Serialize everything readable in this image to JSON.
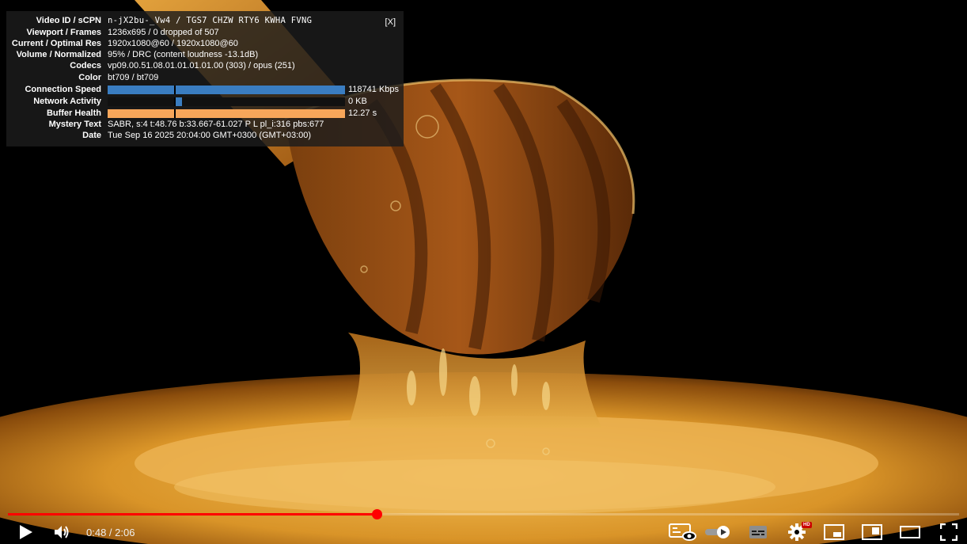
{
  "stats": {
    "close_label": "[X]",
    "rows": [
      {
        "label": "Video ID / sCPN",
        "value": "n-jX2bu-_Vw4 / TGS7 CHZW RTY6 KWHA FVNG"
      },
      {
        "label": "Viewport / Frames",
        "value": "1236x695 / 0 dropped of 507"
      },
      {
        "label": "Current / Optimal Res",
        "value": "1920x1080@60 / 1920x1080@60"
      },
      {
        "label": "Volume / Normalized",
        "value": "95% / DRC (content loudness -13.1dB)"
      },
      {
        "label": "Codecs",
        "value": "vp09.00.51.08.01.01.01.01.00 (303) / opus (251)"
      },
      {
        "label": "Color",
        "value": "bt709 / bt709"
      }
    ],
    "meters": [
      {
        "label": "Connection Speed",
        "value": "118741 Kbps",
        "fill": 1.0,
        "color": "#3a7dc1"
      },
      {
        "label": "Network Activity",
        "value": "0 KB",
        "fill": 0.3,
        "color": "#3a7dc1"
      },
      {
        "label": "Buffer Health",
        "value": "12.27 s",
        "fill": 1.0,
        "color": "#f7a65a"
      }
    ],
    "rows_bottom": [
      {
        "label": "Mystery Text",
        "value": "SABR, s:4 t:48.76 b:33.667-61.027 P L pl_i:316 pbs:677"
      },
      {
        "label": "Date",
        "value": "Tue Sep 16 2025 20:04:00 GMT+0300 (GMT+03:00)"
      }
    ]
  },
  "player": {
    "current_time": "0:48",
    "duration": "2:06",
    "time_display": "0:48 / 2:06",
    "progress_fraction": 0.388,
    "hd_badge": "HD"
  },
  "colors": {
    "progress": "#ff0000",
    "honey": "#e9a21a",
    "background": "#000000"
  },
  "icons": [
    "play-icon",
    "volume-icon",
    "stable-volume-icon",
    "autoplay-toggle-icon",
    "subtitles-icon",
    "settings-icon",
    "miniplayer-icon",
    "theater-mode-icon",
    "fullscreen-icon"
  ]
}
